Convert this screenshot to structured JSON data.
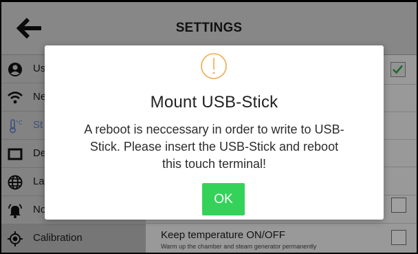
{
  "header": {
    "title": "SETTINGS",
    "back_icon": "arrow-left-icon"
  },
  "sidebar": {
    "items": [
      {
        "label": "Us",
        "icon": "user-circle-icon"
      },
      {
        "label": "Ne",
        "icon": "wifi-icon"
      },
      {
        "label": "St",
        "icon": "thermometer-icon",
        "color": "#5c7cc2"
      },
      {
        "label": "De",
        "icon": "display-icon"
      },
      {
        "label": "La",
        "icon": "globe-icon"
      },
      {
        "label": "No",
        "icon": "bell-icon"
      },
      {
        "label": "Calibration",
        "icon": "target-icon"
      }
    ]
  },
  "main": {
    "rows": [
      {
        "checked": true
      },
      {
        "checked": false
      },
      {
        "title": "Keep temperature ON/OFF",
        "subtitle": "Warm up the chamber and steam generator permanently",
        "checked": false
      }
    ]
  },
  "dialog": {
    "icon": "exclamation-circle-icon",
    "icon_color": "#f2a94a",
    "title": "Mount USB-Stick",
    "message_lines": [
      "A reboot is neccessary in order to write to USB-",
      "Stick. Please insert the USB-Stick and reboot",
      "this touch terminal!"
    ],
    "ok_label": "OK",
    "ok_color": "#35d25a"
  }
}
